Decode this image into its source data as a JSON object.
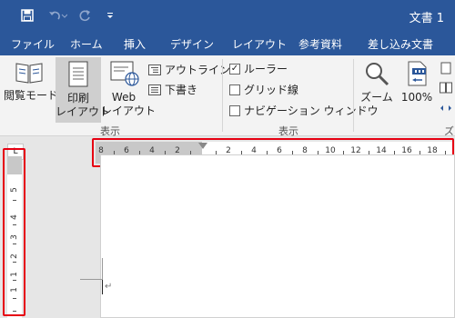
{
  "app": {
    "doc_title": "文書 1",
    "icons": {
      "save": "save-icon",
      "undo": "undo-icon",
      "redo": "redo-icon",
      "more": "customize-quick-access-icon"
    }
  },
  "tabs": [
    "ファイル",
    "ホーム",
    "挿入",
    "デザイン",
    "レイアウト",
    "参考資料",
    "差し込み文書"
  ],
  "ribbon": {
    "views": {
      "read_mode": "閲覧モード",
      "print_layout_l1": "印刷",
      "print_layout_l2": "レイアウト",
      "web_layout_l1": "Web",
      "web_layout_l2": "レイアウト",
      "outline": "アウトライン",
      "draft": "下書き",
      "group_label": "表示"
    },
    "show": {
      "ruler": "ルーラー",
      "ruler_checked": true,
      "gridlines": "グリッド線",
      "gridlines_checked": false,
      "navigation": "ナビゲーション ウィンドウ",
      "navigation_checked": false,
      "group_label": "表示"
    },
    "zoom": {
      "zoom_label": "ズーム",
      "percent_label": "100%",
      "group_label": "ズ"
    }
  },
  "rulers": {
    "horizontal_numbers": [
      "8",
      "6",
      "4",
      "2",
      "2",
      "4",
      "6",
      "8",
      "10",
      "12",
      "14",
      "16",
      "18"
    ],
    "vertical_numbers": [
      "1",
      "1",
      "2",
      "3",
      "4",
      "5"
    ],
    "corner_symbol": "L"
  },
  "colors": {
    "brand": "#2b579a",
    "highlight": "#e60012"
  }
}
